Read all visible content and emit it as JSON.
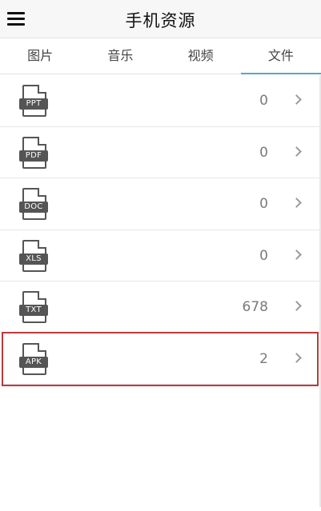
{
  "header": {
    "title": "手机资源",
    "menu_icon": "hamburger-icon"
  },
  "tabs": [
    {
      "label": "图片",
      "active": false
    },
    {
      "label": "音乐",
      "active": false
    },
    {
      "label": "视频",
      "active": false
    },
    {
      "label": "文件",
      "active": true
    }
  ],
  "files": [
    {
      "type": "PPT",
      "count": "0"
    },
    {
      "type": "PDF",
      "count": "0"
    },
    {
      "type": "DOC",
      "count": "0"
    },
    {
      "type": "XLS",
      "count": "0"
    },
    {
      "type": "TXT",
      "count": "678"
    },
    {
      "type": "APK",
      "count": "2",
      "highlighted": true
    }
  ],
  "colors": {
    "tab_underline": "#5aa6c8",
    "highlight_border": "#c0393b",
    "icon": "#555555"
  }
}
